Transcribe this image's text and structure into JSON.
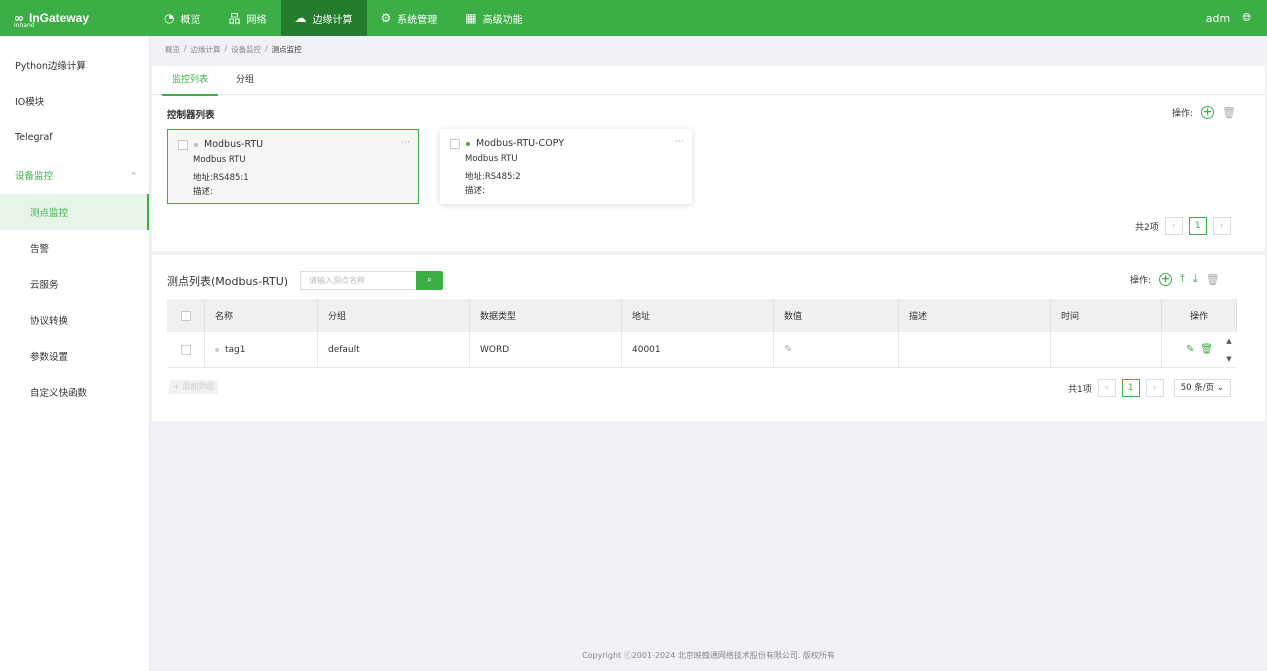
{
  "app": {
    "logo_small": "inhand",
    "logo_text": "InGateway",
    "user": "adm"
  },
  "nav": [
    {
      "label": "概览",
      "icon": "dashboard-icon"
    },
    {
      "label": "网络",
      "icon": "network-icon"
    },
    {
      "label": "边缘计算",
      "icon": "cloud-icon",
      "active": true
    },
    {
      "label": "系统管理",
      "icon": "gear-icon"
    },
    {
      "label": "高级功能",
      "icon": "grid-icon"
    }
  ],
  "sidebar": {
    "items": [
      {
        "label": "Python边缘计算"
      },
      {
        "label": "IO模块"
      },
      {
        "label": "Telegraf"
      },
      {
        "label": "设备监控"
      },
      {
        "label": "测点监控"
      },
      {
        "label": "告警"
      },
      {
        "label": "云服务"
      },
      {
        "label": "协议转换"
      },
      {
        "label": "参数设置"
      },
      {
        "label": "自定义快函数"
      }
    ]
  },
  "breadcrumb": [
    "概览",
    "边缘计算",
    "设备监控",
    "测点监控"
  ],
  "tabs": [
    "监控列表",
    "分组"
  ],
  "controllers": {
    "title": "控制器列表",
    "ops_label": "操作:",
    "cards": [
      {
        "name": "Modbus-RTU",
        "protocol": "Modbus RTU",
        "address": "地址:RS485:1",
        "desc": "描述:"
      },
      {
        "name": "Modbus-RTU-COPY",
        "protocol": "Modbus RTU",
        "address": "地址:RS485:2",
        "desc": "描述:"
      }
    ],
    "pager": {
      "total": "共2项",
      "page": "1"
    }
  },
  "points": {
    "title": "测点列表(Modbus-RTU)",
    "search_placeholder": "请输入测点名称",
    "ops_label": "操作:",
    "headers": [
      "名称",
      "分组",
      "数据类型",
      "地址",
      "数值",
      "描述",
      "时间",
      "操作"
    ],
    "rows": [
      {
        "name": "tag1",
        "group": "default",
        "type": "WORD",
        "address": "40001",
        "desc": "",
        "time": ""
      }
    ],
    "add_group": "+ 添加到组",
    "pager": {
      "total": "共1项",
      "page": "1",
      "size": "50 条/页"
    }
  },
  "footer": "Copyright ⓒ2001-2024 北京映翰通网络技术股份有限公司. 版权所有"
}
